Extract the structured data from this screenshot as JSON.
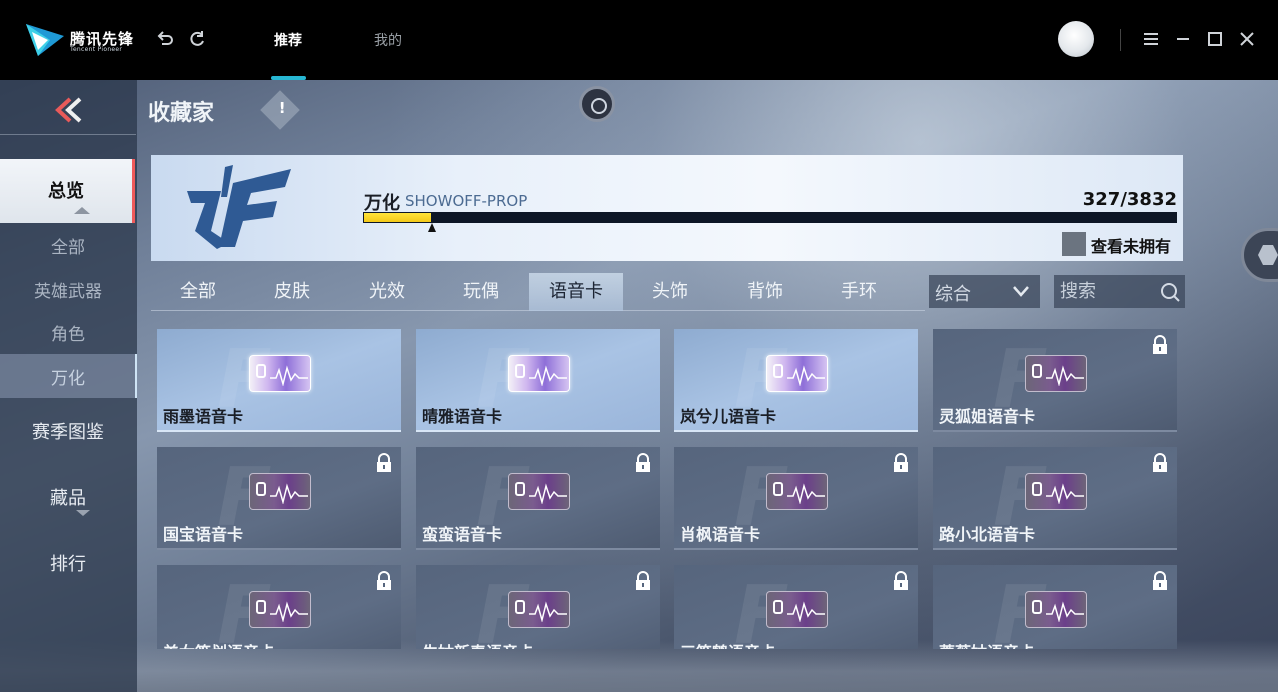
{
  "app": {
    "logo_text": "腾讯先锋",
    "logo_sub": "Tencent Pioneer",
    "tabs": [
      {
        "label": "推荐",
        "active": true
      },
      {
        "label": "我的",
        "active": false
      }
    ],
    "accent_color": "#27b7d3"
  },
  "sidebar": {
    "items": [
      {
        "label": "总览",
        "active": true
      },
      {
        "label": "全部",
        "sub": true
      },
      {
        "label": "英雄武器",
        "sub": true
      },
      {
        "label": "角色",
        "sub": true
      },
      {
        "label": "万化",
        "sub": true,
        "active": true
      },
      {
        "label": "赛季图鉴"
      },
      {
        "label": "藏品"
      },
      {
        "label": "排行"
      }
    ]
  },
  "page": {
    "title": "收藏家",
    "info_icon": "!"
  },
  "banner": {
    "label": "万化",
    "code": "SHOWOFF-PROP",
    "owned": 327,
    "total": 3832,
    "count_text": "327/3832",
    "progress": 0.085,
    "toggle_label": "查看未拥有"
  },
  "categories": [
    {
      "label": "全部",
      "active": false
    },
    {
      "label": "皮肤",
      "active": false
    },
    {
      "label": "光效",
      "active": false
    },
    {
      "label": "玩偶",
      "active": false
    },
    {
      "label": "语音卡",
      "active": true
    },
    {
      "label": "头饰",
      "active": false
    },
    {
      "label": "背饰",
      "active": false
    },
    {
      "label": "手环",
      "active": false
    }
  ],
  "sort": {
    "selected": "综合"
  },
  "search": {
    "placeholder": "搜索"
  },
  "cards": [
    {
      "name": "雨墨语音卡",
      "locked": false
    },
    {
      "name": "晴雅语音卡",
      "locked": false
    },
    {
      "name": "岚兮儿语音卡",
      "locked": false
    },
    {
      "name": "灵狐姐语音卡",
      "locked": true
    },
    {
      "name": "国宝语音卡",
      "locked": true
    },
    {
      "name": "蛮蛮语音卡",
      "locked": true
    },
    {
      "name": "肖枫语音卡",
      "locked": true
    },
    {
      "name": "路小北语音卡",
      "locked": true
    },
    {
      "name": "美女策划语音卡",
      "locked": true
    },
    {
      "name": "生姑新春语音卡",
      "locked": true
    },
    {
      "name": "三符鹤语音卡",
      "locked": true
    },
    {
      "name": "蔷薇姑语音卡",
      "locked": true
    }
  ]
}
